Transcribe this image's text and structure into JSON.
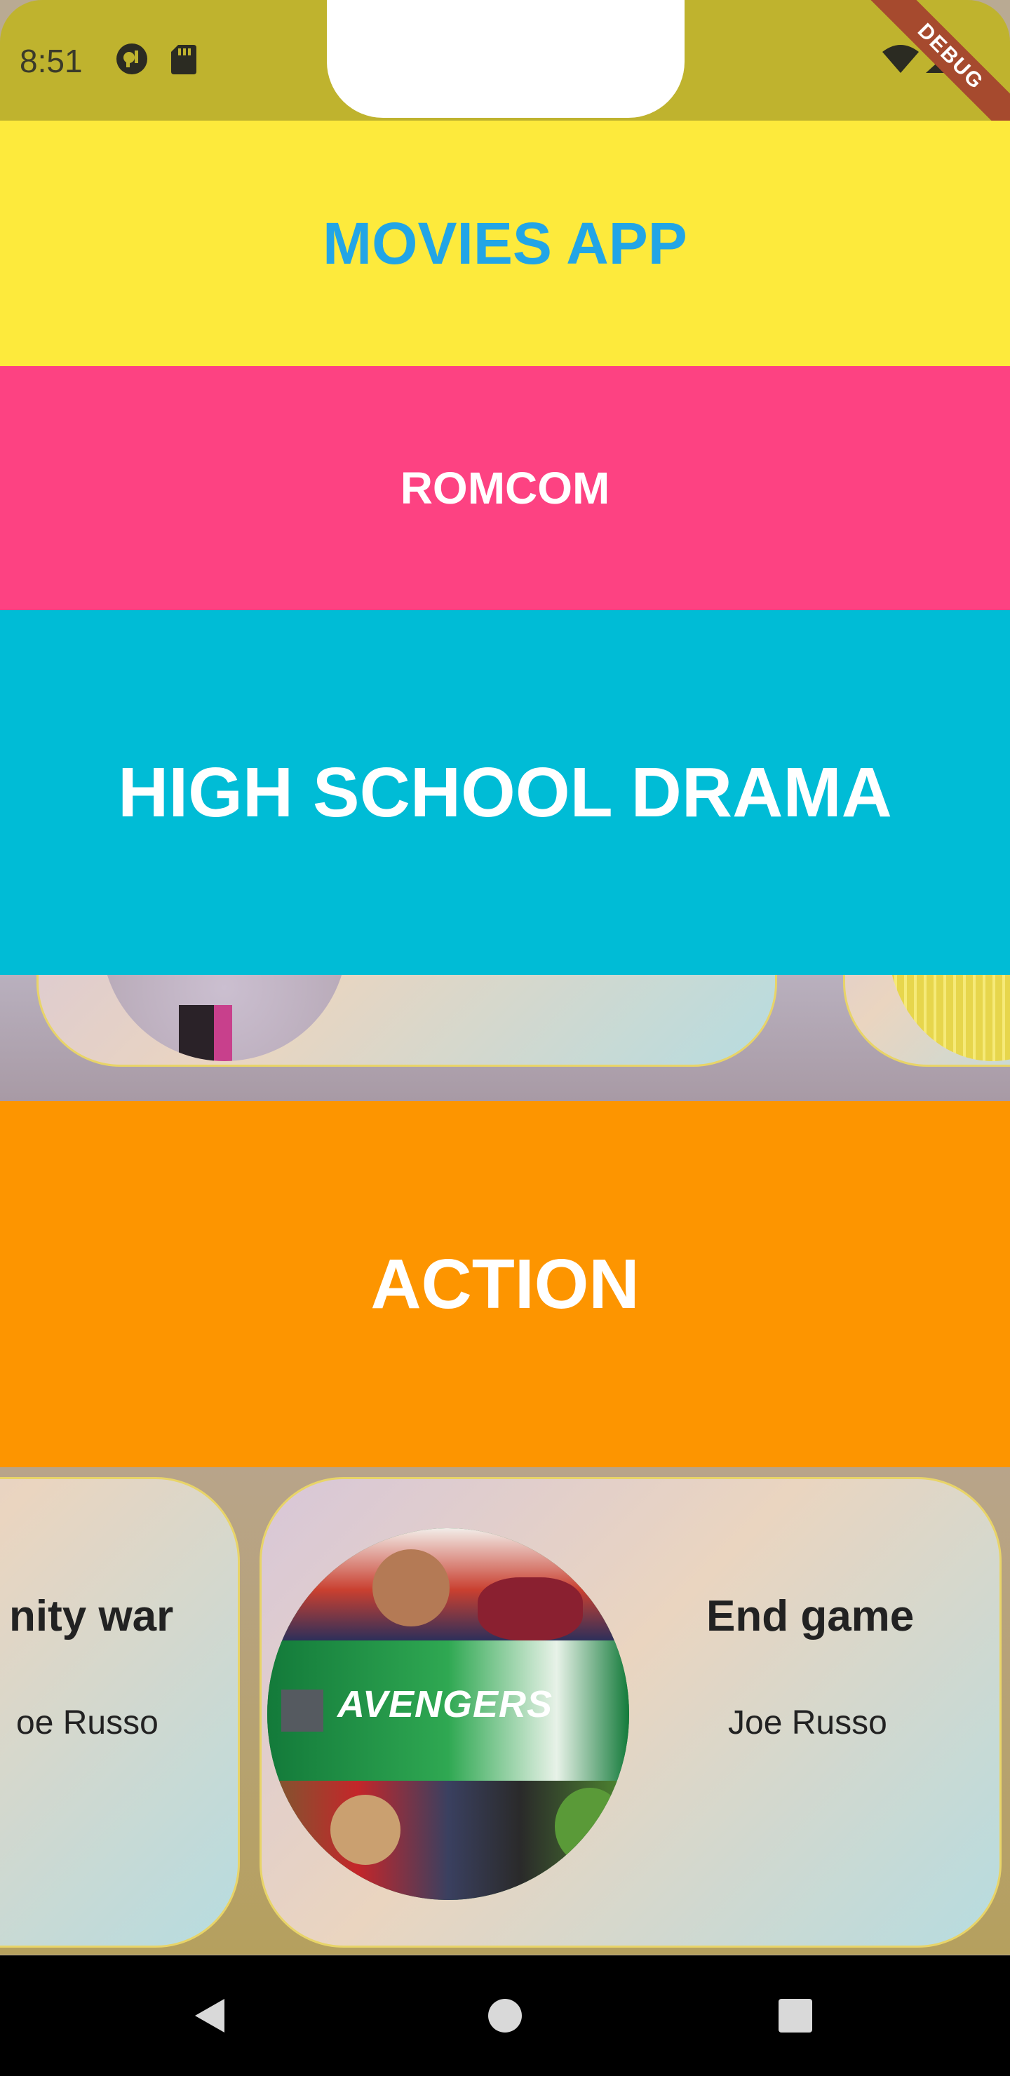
{
  "status_bar": {
    "time": "8:51",
    "icons": [
      "podcast-icon",
      "sd-card-icon",
      "wifi-icon",
      "signal-icon"
    ],
    "debug_label": "DEBUG"
  },
  "app": {
    "title": "MOVIES APP"
  },
  "sections": {
    "romcom": "ROMCOM",
    "high_school_drama": "HIGH SCHOOL DRAMA",
    "action": "ACTION"
  },
  "action_movies": [
    {
      "title": "nity war",
      "director": "oe Russo"
    },
    {
      "title": "End game",
      "director": "Joe Russo"
    }
  ],
  "colors": {
    "status_bar": "#bfb32e",
    "title_band": "#fdea3c",
    "title_text": "#22a5e6",
    "romcom_band": "#fd4282",
    "high_school_band": "#00bcd6",
    "action_band": "#fd9500"
  },
  "nav_bar": {
    "buttons": [
      "back-icon",
      "home-icon",
      "recents-icon"
    ]
  }
}
